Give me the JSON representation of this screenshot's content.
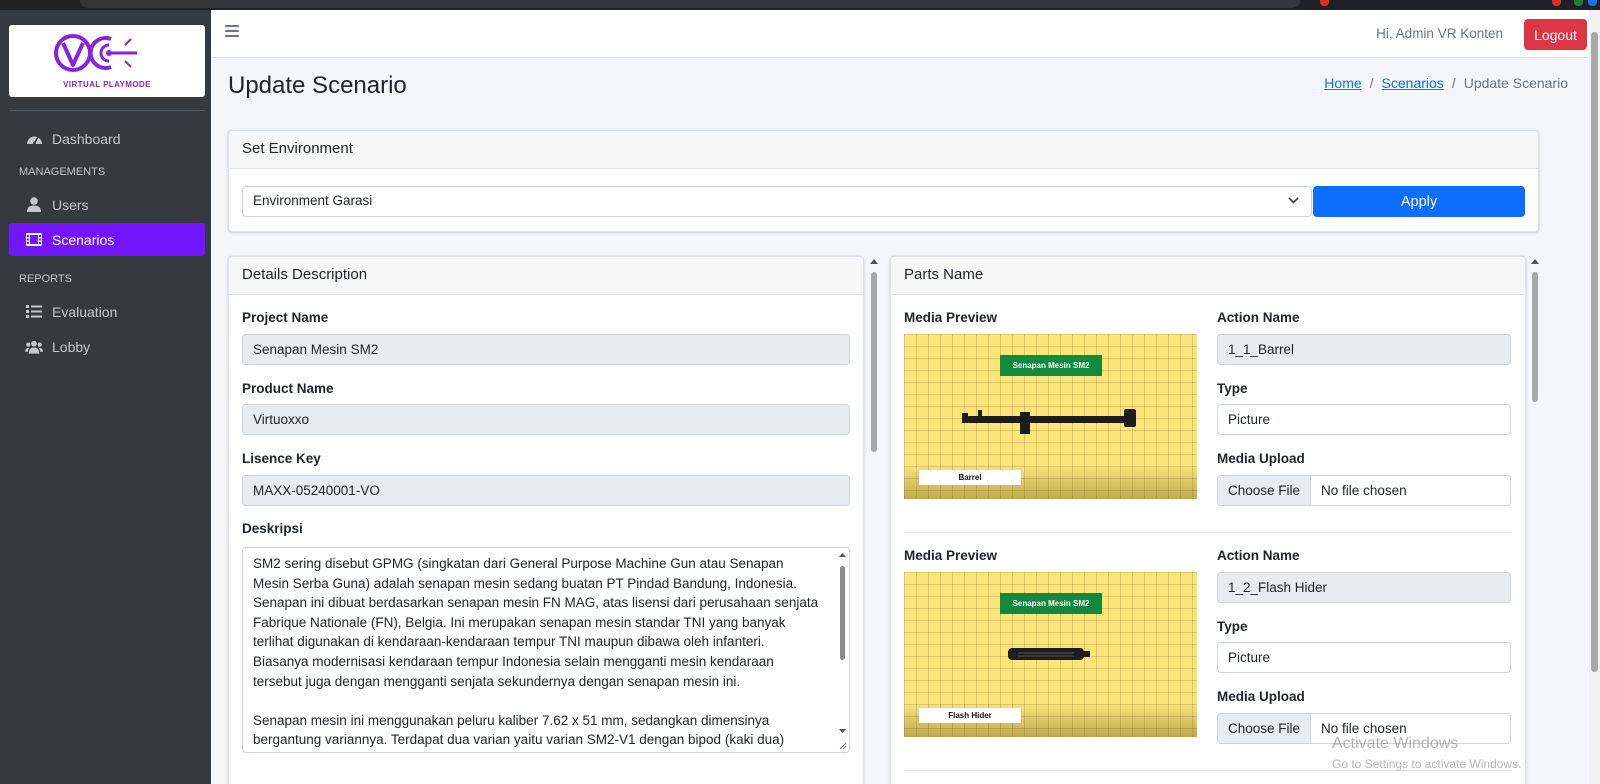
{
  "brand": {
    "name": "VIRTUAL PLAYMODE",
    "accent": "#8a22e0"
  },
  "sidebar": {
    "items": [
      {
        "label": "Dashboard",
        "icon": "gauge-icon"
      },
      {
        "label": "Users",
        "icon": "user-icon"
      },
      {
        "label": "Scenarios",
        "icon": "film-icon",
        "active": true
      },
      {
        "label": "Evaluation",
        "icon": "list-icon"
      },
      {
        "label": "Lobby",
        "icon": "users-icon"
      }
    ],
    "headers": [
      "MANAGEMENTS",
      "REPORTS"
    ],
    "active_color": "#7316ff"
  },
  "topbar": {
    "greeting": "Hi, Admin VR Konten",
    "logout_label": "Logout"
  },
  "page": {
    "title": "Update Scenario"
  },
  "breadcrumb": {
    "home": "Home",
    "scenarios": "Scenarios",
    "current": "Update Scenario",
    "sep": "/"
  },
  "environment": {
    "card_title": "Set Environment",
    "selected": "Environment Garasi",
    "apply_label": "Apply"
  },
  "details": {
    "card_title": "Details Description",
    "project_label": "Project Name",
    "project_value": "Senapan Mesin SM2",
    "product_label": "Product Name",
    "product_value": "Virtuoxxo",
    "license_label": "Lisence Key",
    "license_value": "MAXX-05240001-VO",
    "desc_label": "Deskripsi",
    "desc_p1": "SM2 sering disebut GPMG (singkatan dari General Purpose Machine Gun atau Senapan Mesin Serba Guna) adalah senapan mesin sedang buatan PT Pindad Bandung, Indonesia. Senapan ini dibuat berdasarkan senapan mesin FN MAG, atas lisensi dari perusahaan senjata Fabrique Nationale (FN), Belgia. Ini merupakan senapan mesin standar TNI yang banyak terlihat digunakan di kendaraan-kendaraan tempur TNI maupun dibawa oleh infanteri. Biasanya modernisasi kendaraan tempur Indonesia selain mengganti mesin kendaraan tersebut juga dengan mengganti senjata sekundernya dengan senapan mesin ini.",
    "desc_p2": "Senapan mesin ini menggunakan peluru kaliber 7.62 x 51 mm, sedangkan dimensinya bergantung variannya. Terdapat dua varian yaitu varian SM2-V1 dengan bipod (kaki dua) terintegrasi. Dengan"
  },
  "parts": {
    "card_title": "Parts Name",
    "items": [
      {
        "preview_label": "Media Preview",
        "banner": "Senapan Mesin SM2",
        "caption": "Barrel",
        "action_label": "Action Name",
        "action_value": "1_1_Barrel",
        "type_label": "Type",
        "type_value": "Picture",
        "upload_label": "Media Upload",
        "choose_label": "Choose File",
        "file_value": "No file chosen"
      },
      {
        "preview_label": "Media Preview",
        "banner": "Senapan Mesin SM2",
        "caption": "Flash Hider",
        "action_label": "Action Name",
        "action_value": "1_2_Flash Hider",
        "type_label": "Type",
        "type_value": "Picture",
        "upload_label": "Media Upload",
        "choose_label": "Choose File",
        "file_value": "No file chosen"
      }
    ]
  },
  "watermark": {
    "line1": "Activate Windows",
    "line2": "Go to Settings to activate Windows."
  }
}
